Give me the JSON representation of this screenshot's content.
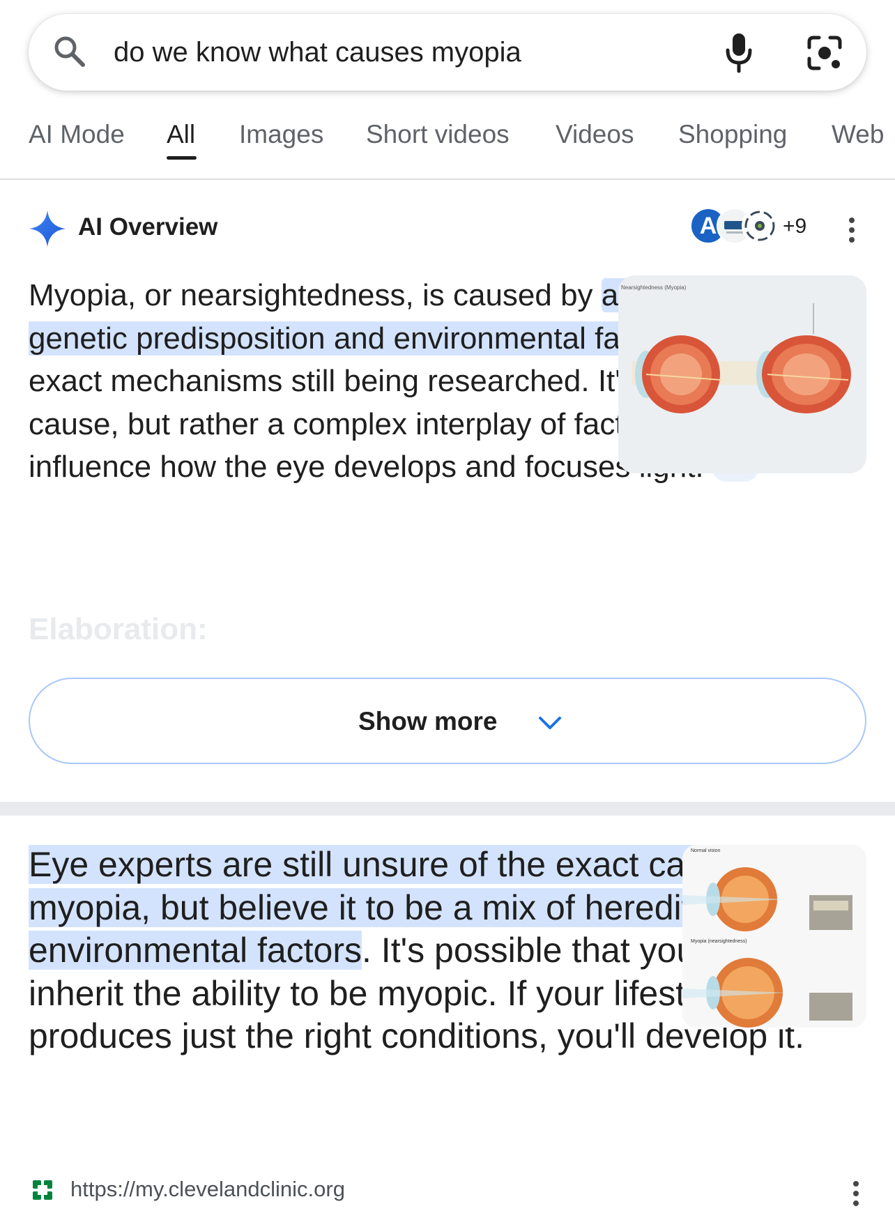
{
  "search": {
    "query": "do we know what causes myopia",
    "icons": [
      "search-icon",
      "microphone-icon",
      "lens-camera-icon"
    ]
  },
  "tabs": [
    {
      "label": "AI Mode",
      "active": false
    },
    {
      "label": "All",
      "active": true
    },
    {
      "label": "Images",
      "active": false
    },
    {
      "label": "Short videos",
      "active": false
    },
    {
      "label": "Videos",
      "active": false
    },
    {
      "label": "Shopping",
      "active": false
    },
    {
      "label": "Web",
      "active": false
    }
  ],
  "ai_overview": {
    "title": "AI Overview",
    "source_avatar_letter": "A",
    "sources_more": "+9",
    "text_before": "Myopia, or nearsightedness, is caused by ",
    "text_highlight": "a combination of genetic predisposition and environmental factors",
    "text_after": ", with the exact mechanisms still being researched. It's not a single cause, but rather a complex interplay of factors that influence how the eye develops and focuses light.",
    "image_caption": "Nearsightedness (Myopia)",
    "elaboration_heading": "Elaboration:",
    "show_more_label": "Show more"
  },
  "featured_snippet": {
    "text_highlight": "Eye experts are still unsure of the exact cause of myopia, but believe it to be a mix of hereditary and environmental factors",
    "text_after": ". It's possible that you can inherit the ability to be myopic. If your lifestyle produces just the right conditions, you'll develop it.",
    "image_labels": [
      "Normal vision",
      "Myopia (nearsightedness)"
    ],
    "source_url": "https://my.clevelandclinic.org"
  },
  "colors": {
    "highlight": "#d3e3fd",
    "accent_blue": "#1a73e8",
    "show_more_border": "#a8c7fa"
  }
}
